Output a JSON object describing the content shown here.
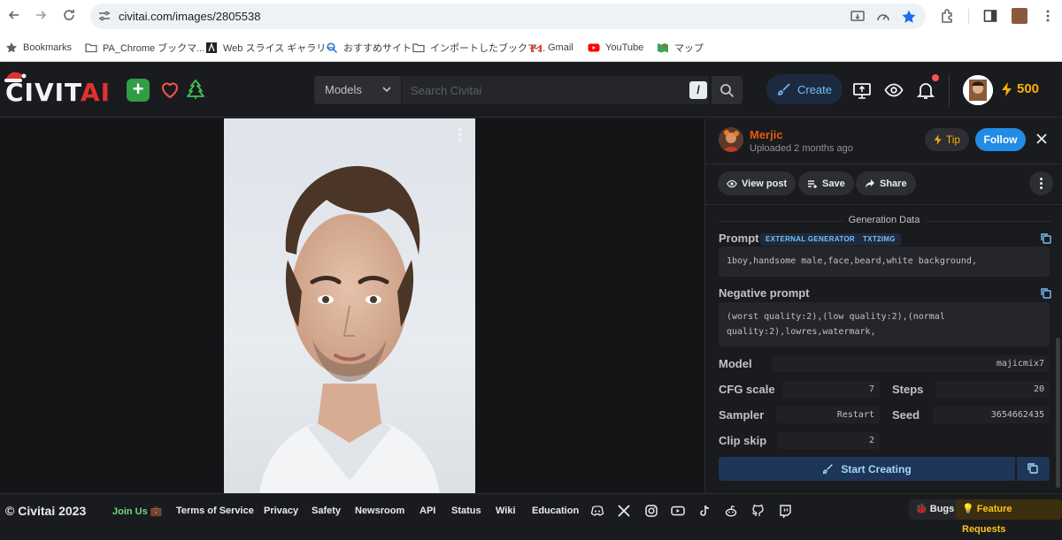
{
  "browser": {
    "url": "civitai.com/images/2805538",
    "bookmarks": [
      {
        "label": "Bookmarks",
        "icon": "star-icon"
      },
      {
        "label": "PA_Chrome ブックマ...",
        "icon": "folder-icon"
      },
      {
        "label": "Web スライス ギャラリー",
        "icon": "web-slice-icon"
      },
      {
        "label": "おすすめサイト",
        "icon": "search-icon"
      },
      {
        "label": "インポートしたブックマ...",
        "icon": "folder-icon"
      },
      {
        "label": "Gmail",
        "icon": "gmail-icon"
      },
      {
        "label": "YouTube",
        "icon": "youtube-icon"
      },
      {
        "label": "マップ",
        "icon": "maps-icon"
      }
    ]
  },
  "header": {
    "logo_main": "CIVIT",
    "logo_accent": "AI",
    "search_category": "Models",
    "search_placeholder": "Search Civitai",
    "search_shortcut": "/",
    "create_label": "Create",
    "buzz_amount": "500",
    "accent": "#228be6"
  },
  "post": {
    "author": "Merjic",
    "uploaded": "Uploaded 2 months ago",
    "tip_label": "Tip",
    "follow_label": "Follow",
    "view_post_label": "View post",
    "save_label": "Save",
    "share_label": "Share"
  },
  "generation": {
    "title": "Generation Data",
    "prompt_label": "Prompt",
    "badges": [
      "EXTERNAL GENERATOR",
      "TXT2IMG"
    ],
    "prompt": "1boy,handsome male,face,beard,white background,",
    "negative_label": "Negative prompt",
    "negative_line1": "(worst quality:2),(low quality:2),(normal",
    "negative_line2": "quality:2),lowres,watermark,",
    "model_label": "Model",
    "model": "majicmix7",
    "cfg_label": "CFG scale",
    "cfg": "7",
    "steps_label": "Steps",
    "steps": "20",
    "sampler_label": "Sampler",
    "sampler": "Restart",
    "seed_label": "Seed",
    "seed": "3654662435",
    "clip_label": "Clip skip",
    "clip": "2",
    "start_label": "Start Creating"
  },
  "footer": {
    "copyright": "© Civitai 2023",
    "join": "Join Us 💼",
    "links": [
      "Terms of Service",
      "Privacy",
      "Safety",
      "Newsroom",
      "API",
      "Status",
      "Wiki",
      "Education"
    ],
    "social_icons": [
      "discord-icon",
      "x-icon",
      "instagram-icon",
      "youtube-icon",
      "tiktok-icon",
      "reddit-icon",
      "github-icon",
      "twitch-icon"
    ],
    "bugs": "🐞 Bugs",
    "feature_requests": "💡 Feature Requests"
  }
}
